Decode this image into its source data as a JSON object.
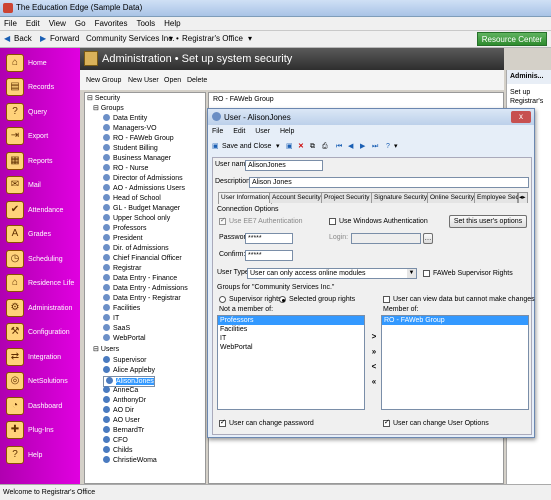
{
  "app": {
    "title": "The Education Edge (Sample Data)"
  },
  "menu": [
    "File",
    "Edit",
    "View",
    "Go",
    "Favorites",
    "Tools",
    "Help"
  ],
  "nav": {
    "back": "Back",
    "forward": "Forward",
    "org": "Community Services Inc.",
    "office": "Registrar's Office",
    "resource": "Resource Center"
  },
  "sidebar": [
    "Home",
    "Records",
    "Query",
    "Export",
    "Reports",
    "Mail",
    "Attendance",
    "Grades",
    "Scheduling",
    "Residence Life",
    "Administration",
    "Configuration",
    "Integration",
    "NetSolutions",
    "Dashboard",
    "Plug-Ins",
    "Help"
  ],
  "header": {
    "title": "Administration • Set up system security"
  },
  "toolbar": {
    "new_group": "New Group",
    "new_user": "New User",
    "open": "Open",
    "delete": "Delete"
  },
  "right_panel": {
    "title": "Adminis...",
    "text": "Set up Registrar's"
  },
  "tree": {
    "root": "Security",
    "groups_label": "Groups",
    "groups": [
      "Data Entity",
      "Managers-VO",
      "RO - FAWeb Group",
      "Student Billing",
      "Business Manager",
      "RO - Nurse",
      "Director of Admissions",
      "AO - Admissions Users",
      "Head of School",
      "GL - Budget Manager",
      "Upper School only",
      "Professors",
      "President",
      "Dir. of Admissions",
      "Chief Financial Officer",
      "Registrar",
      "Data Entry - Finance",
      "Data Entry - Admissions",
      "Data Entry - Registrar",
      "Facilities",
      "IT",
      "SaaS",
      "WebPortal"
    ],
    "users_label": "Users",
    "users": [
      "Supervisor",
      "Alice Appleby",
      "AlisonJones",
      "AnneCa",
      "AnthonyDr",
      "AO Dir",
      "AO User",
      "BernardTr",
      "CFO",
      "Childs",
      "ChristieWoma"
    ]
  },
  "bg_window": {
    "title": "RO - FAWeb Group"
  },
  "dialog": {
    "title": "User - AlisonJones",
    "close": "x",
    "menu": [
      "File",
      "Edit",
      "User",
      "Help"
    ],
    "save_close": "Save and Close",
    "username_label": "User name:",
    "username": "AlisonJones",
    "desc_label": "Description:",
    "desc": "Alison Jones",
    "tabs": [
      "User Information",
      "Account Security",
      "Project Security",
      "Signature Security",
      "Online Security",
      "Employee Securi"
    ],
    "conn_opts": "Connection Options",
    "use_ee7": "Use EE7 Authentication",
    "use_win": "Use Windows Authentication",
    "set_options": "Set this user's options",
    "password_label": "Password:",
    "password": "*****",
    "login_label": "Login:",
    "confirm_label": "Confirm:",
    "confirm": "*****",
    "usertype_label": "User Type:",
    "usertype": "User can only access online modules",
    "faweb_rights": "FAWeb Supervisor Rights",
    "groups_for": "Groups for \"Community Services Inc.\"",
    "supervisor_rights": "Supervisor rights",
    "selected_rights": "Selected group rights",
    "view_no_change": "User can view data but cannot make changes",
    "not_member": "Not a member of:",
    "member_of": "Member of:",
    "not_member_list": [
      "Professors",
      "Facilities",
      "IT",
      "WebPortal"
    ],
    "member_list": [
      "RO - FAWeb Group"
    ],
    "arrows": [
      ">",
      "»",
      "<",
      "«"
    ],
    "change_password": "User can change password",
    "change_options": "User can change User Options"
  },
  "status": "Welcome to Registrar's Office"
}
